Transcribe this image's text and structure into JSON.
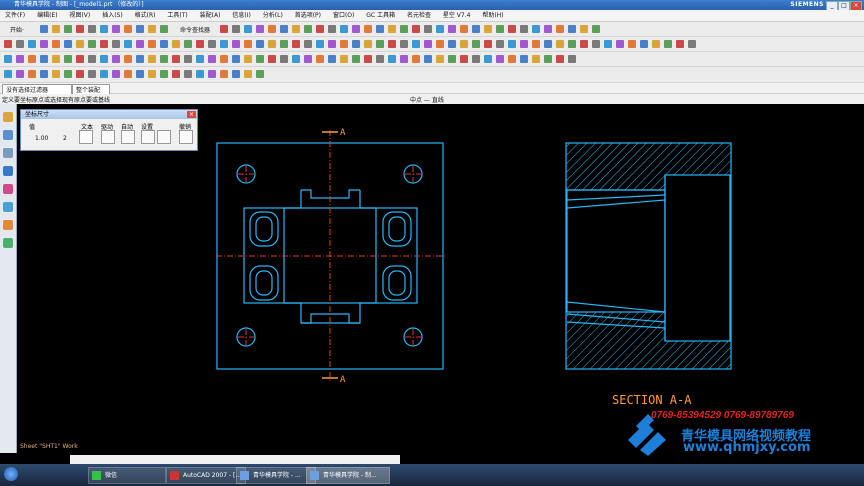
{
  "window": {
    "title": "青华模具学院 - 制图 - [_model1.prt （修改的）]",
    "brand": "SIEMENS",
    "controls": [
      "_",
      "□",
      "×"
    ]
  },
  "menu": [
    "文件(F)",
    "编辑(E)",
    "视图(V)",
    "插入(S)",
    "格式(R)",
    "工具(T)",
    "装配(A)",
    "信息(I)",
    "分析(L)",
    "首选项(P)",
    "窗口(O)",
    "GC 工具箱",
    "名元检查",
    "星空 V7.4",
    "帮助(H)"
  ],
  "toolbar": {
    "start_label": "开始·",
    "command_finder": "命令查找器"
  },
  "filter": {
    "selection_filter": "没有选择过滤器",
    "assembly": "整个装配"
  },
  "status": {
    "prompt": "定义要坐标原点或选择现有原点要或基线",
    "snap": "中点 — 直线"
  },
  "dialog": {
    "title": "坐标尺寸",
    "columns": [
      "值",
      "文本",
      "驱动",
      "自动",
      "设置",
      "撤销"
    ],
    "value": "1.00",
    "precision": "2"
  },
  "drawing": {
    "section_label": "SECTION A-A",
    "marker_top": "A",
    "marker_bottom": "A",
    "sheet_label": "Sheet \"SHT1\" Work"
  },
  "watermark": {
    "phones": "0769-85394529  0769-89789769",
    "name": "青华模具网络视频教程",
    "url": "www.qhmjxy.com"
  },
  "taskbar": {
    "items": [
      "微信",
      "AutoCAD 2007 - [...",
      "青华模具学院 - ...",
      "青华模具学院 - 制..."
    ]
  },
  "colors": {
    "geometry": "#29b6f6",
    "centerline": "#e53935",
    "annotation": "#ff9a3a"
  }
}
